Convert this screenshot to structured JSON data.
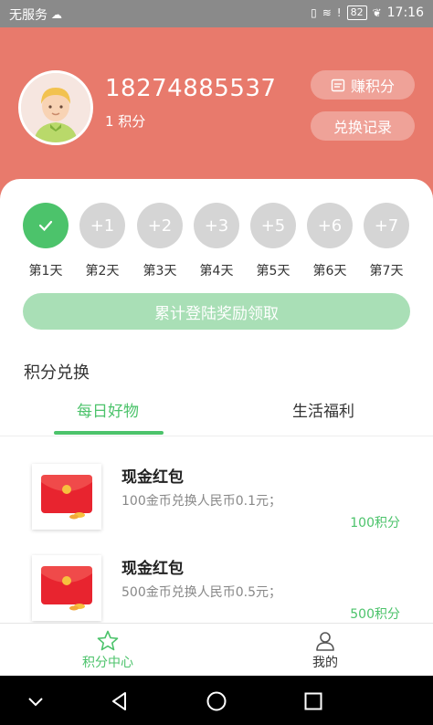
{
  "status_bar": {
    "carrier": "无服务",
    "battery": "82",
    "time": "17:16"
  },
  "profile": {
    "phone": "18274885537",
    "points": "1 积分"
  },
  "actions": {
    "earn_label": "赚积分",
    "record_label": "兑换记录"
  },
  "checkin": {
    "days": [
      {
        "badge": "",
        "label": "第1天",
        "done": true
      },
      {
        "badge": "+1",
        "label": "第2天",
        "done": false
      },
      {
        "badge": "+2",
        "label": "第3天",
        "done": false
      },
      {
        "badge": "+3",
        "label": "第4天",
        "done": false
      },
      {
        "badge": "+5",
        "label": "第5天",
        "done": false
      },
      {
        "badge": "+6",
        "label": "第6天",
        "done": false
      },
      {
        "badge": "+7",
        "label": "第7天",
        "done": false
      }
    ],
    "claim_label": "累计登陆奖励领取"
  },
  "exchange": {
    "title": "积分兑换",
    "tabs": [
      {
        "label": "每日好物"
      },
      {
        "label": "生活福利"
      }
    ],
    "items": [
      {
        "name": "现金红包",
        "desc": "100金币兑换人民币0.1元；",
        "cost": "100积分"
      },
      {
        "name": "现金红包",
        "desc": "500金币兑换人民币0.5元；",
        "cost": "500积分"
      }
    ]
  },
  "tabbar": {
    "home_label": "积分中心",
    "mine_label": "我的"
  },
  "colors": {
    "header": "#e87a6c",
    "accent": "#4cc36b",
    "inactive_circle": "#d5d5d5"
  }
}
